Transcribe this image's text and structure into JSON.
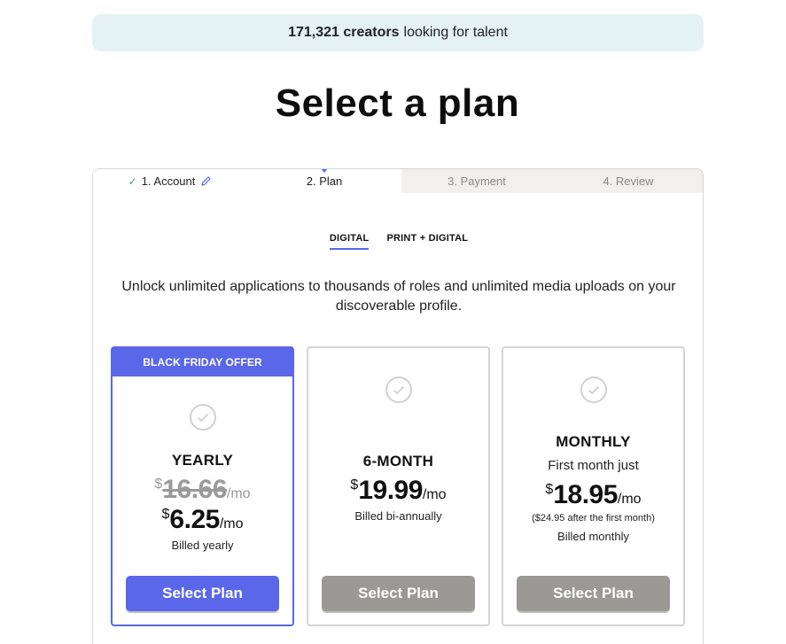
{
  "banner": {
    "count": "171,321 creators",
    "text": "looking for talent"
  },
  "page_title": "Select a plan",
  "steps": [
    {
      "label": "1. Account"
    },
    {
      "label": "2. Plan"
    },
    {
      "label": "3. Payment"
    },
    {
      "label": "4. Review"
    }
  ],
  "tabs": [
    {
      "label": "DIGITAL",
      "active": true
    },
    {
      "label": "PRINT + DIGITAL",
      "active": false
    }
  ],
  "description": "Unlock unlimited applications to thousands of roles and unlimited media uploads on your discoverable profile.",
  "plans": [
    {
      "badge": "BLACK FRIDAY OFFER",
      "name": "YEARLY",
      "old_currency": "$",
      "old_price": "16.66",
      "old_period": "/mo",
      "currency": "$",
      "price": "6.25",
      "period": "/mo",
      "billing": "Billed yearly",
      "button": "Select Plan"
    },
    {
      "name": "6-MONTH",
      "currency": "$",
      "price": "19.99",
      "period": "/mo",
      "billing": "Billed bi-annually",
      "button": "Select Plan"
    },
    {
      "name": "MONTHLY",
      "intro": "First month just",
      "currency": "$",
      "price": "18.95",
      "period": "/mo",
      "note": "($24.95 after the first month)",
      "billing": "Billed monthly",
      "button": "Select Plan"
    }
  ],
  "colors": {
    "accent": "#5a67e8",
    "banner_bg": "#e4f2f2",
    "muted_button": "#9b9994",
    "check_green": "#3aa17a"
  },
  "icons": {
    "step_done": "check-icon",
    "step_edit": "pencil-icon",
    "plan_select": "circle-check-icon"
  }
}
